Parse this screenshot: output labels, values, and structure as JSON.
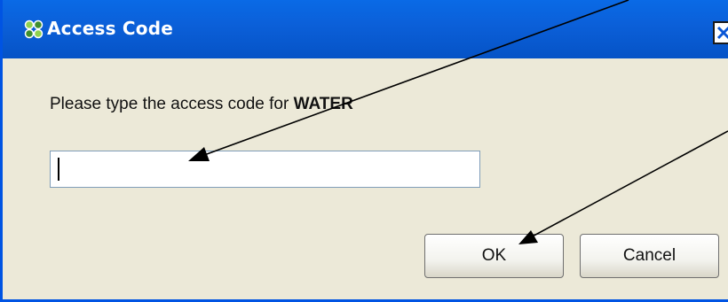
{
  "window": {
    "title": "Access Code",
    "icon": "access-key-icon",
    "close_icon": "close-icon"
  },
  "dialog": {
    "prompt_prefix": "Please type the access code for ",
    "prompt_subject": "WATER",
    "code_value": "",
    "ok_label": "OK",
    "cancel_label": "Cancel"
  },
  "annotations": {
    "arrows": [
      "arrow-to-code-field",
      "arrow-to-ok-button"
    ]
  }
}
